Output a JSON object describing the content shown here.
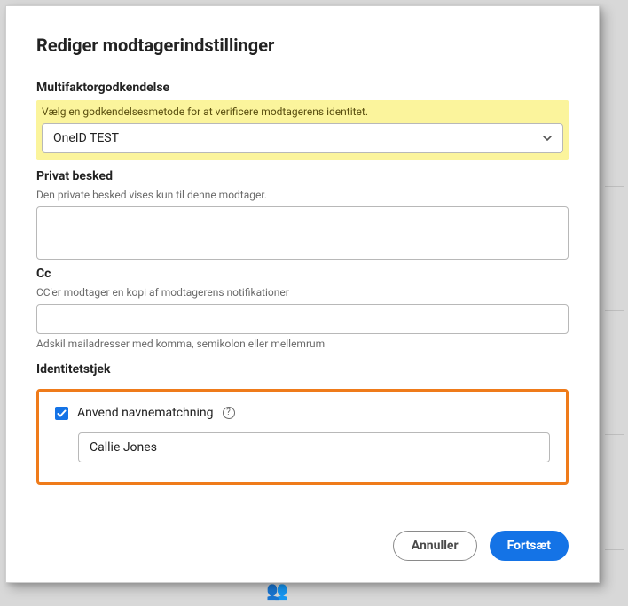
{
  "modal": {
    "title": "Rediger modtagerindstillinger"
  },
  "mfa": {
    "section_label": "Multifaktorgodkendelse",
    "hint": "Vælg en godkendelsesmetode for at verificere modtagerens identitet.",
    "selected": "OneID TEST"
  },
  "private_message": {
    "section_label": "Privat besked",
    "hint": "Den private besked vises kun til denne modtager.",
    "value": ""
  },
  "cc": {
    "section_label": "Cc",
    "hint": "CC'er modtager en kopi af modtagerens notifikationer",
    "value": "",
    "below_hint": "Adskil mailadresser med komma, semikolon eller mellemrum"
  },
  "identity": {
    "section_label": "Identitetstjek",
    "checkbox_label": "Anvend navnematchning",
    "checked": true,
    "name_value": "Callie Jones"
  },
  "footer": {
    "cancel": "Annuller",
    "continue": "Fortsæt"
  }
}
